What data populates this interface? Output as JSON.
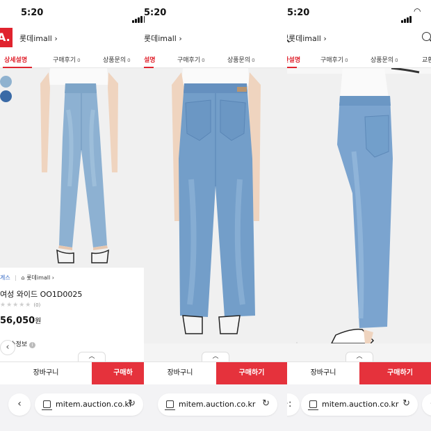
{
  "status": {
    "time": "5:20"
  },
  "header": {
    "logo_text": "A.",
    "seller_link": "롯데imall ›"
  },
  "tabs": [
    {
      "label": "상세설명"
    },
    {
      "label": "구매후기",
      "count": "0"
    },
    {
      "label": "상품문의",
      "count": "0"
    },
    {
      "label": "교환"
    }
  ],
  "tabs_partial": {
    "p2_first": "설명",
    "p3_first": "교환설명"
  },
  "product": {
    "breadcrumb_first": "게스",
    "breadcrumb_second": "롯데imall ›",
    "title": "여성 와이드 OO1D0025",
    "stars": "★★★★★",
    "review_count": "(0)",
    "price": "56,050",
    "price_unit": "원",
    "shipping_label": "배송정보"
  },
  "swatches": [
    "#8fb2cf",
    "#3a6aa6"
  ],
  "actions": {
    "cart_label": "장바구니",
    "buy_label": "구매하기",
    "buy_label_clipped": "구매하"
  },
  "browser": {
    "url": "mitem.auction.co.kr",
    "back_icon": "‹",
    "more_icon": "·:",
    "reload_icon": "↻"
  },
  "colors": {
    "accent_red": "#e0232e",
    "buy_button": "#e5323c",
    "denim_light": "#8db1d2",
    "denim_mid": "#6d96c2",
    "link_blue": "#2b62c2"
  }
}
